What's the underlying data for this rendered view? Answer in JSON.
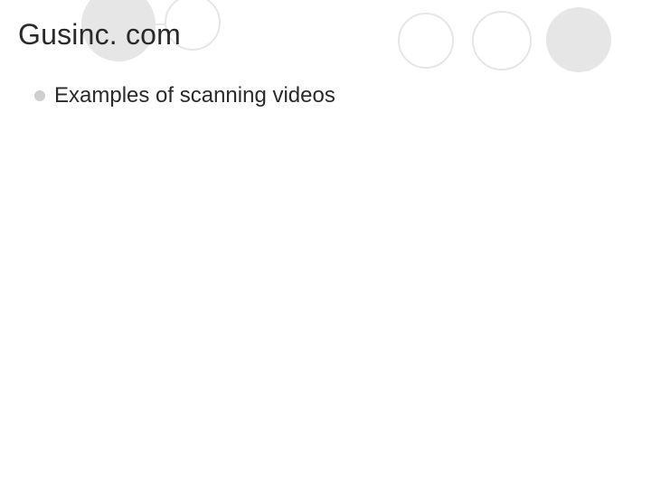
{
  "title": "Gusinc. com",
  "bullets": [
    {
      "text": "Examples of scanning videos"
    }
  ]
}
